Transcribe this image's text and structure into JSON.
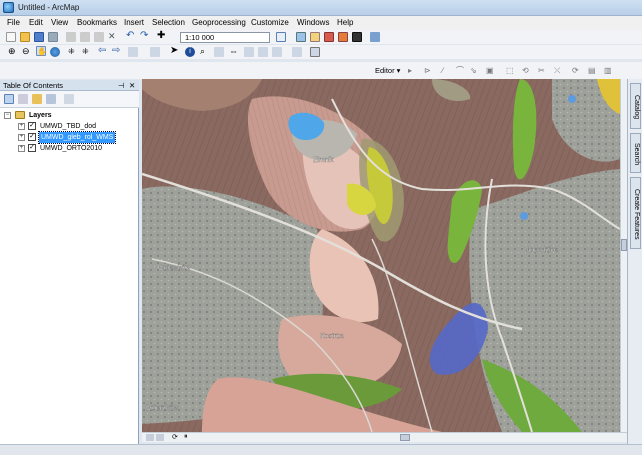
{
  "window": {
    "title": "Untitled - ArcMap"
  },
  "menu": [
    "File",
    "Edit",
    "View",
    "Bookmarks",
    "Insert",
    "Selection",
    "Geoprocessing",
    "Customize",
    "Windows",
    "Help"
  ],
  "toolbar": {
    "scale": "1:10 000",
    "editor_label": "Editor"
  },
  "toc": {
    "title": "Table Of Contents",
    "root_label": "Layers",
    "layers": [
      {
        "label": "UMWD_TBD_dod",
        "checked": true,
        "selected": false
      },
      {
        "label": "UMWD_gleb_rol_WMS",
        "checked": true,
        "selected": true
      },
      {
        "label": "UMWD_ORTO2010",
        "checked": true,
        "selected": false
      }
    ]
  },
  "map": {
    "place_labels": [
      "Zimnik",
      "Gniewków",
      "Kostrza",
      "Nogodzice",
      "Dzierzków"
    ]
  },
  "right_panel": {
    "tabs": [
      "Catalog",
      "Search",
      "Create Features"
    ]
  }
}
